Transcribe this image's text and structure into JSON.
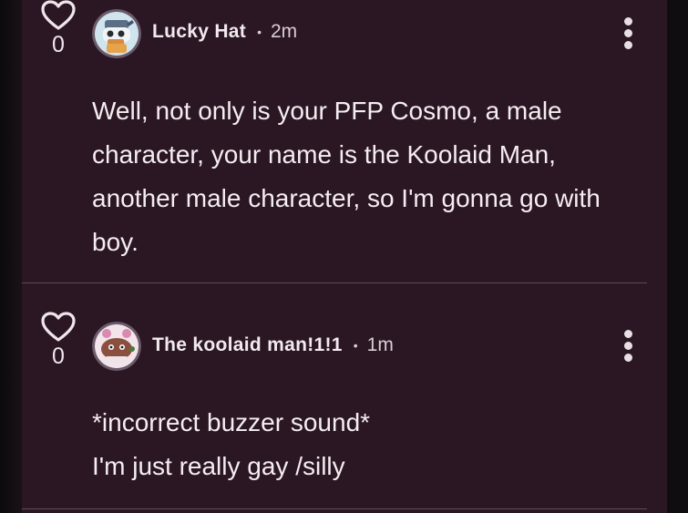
{
  "comments": [
    {
      "likes": "0",
      "username": "Lucky Hat",
      "separator": "•",
      "time": "2m",
      "text_lines": [
        "Well, not only is your PFP Cosmo, a male",
        "character, your name is the Koolaid Man,",
        "another male character, so I'm gonna go with",
        "boy."
      ],
      "avatar_icon": "cartoon-character-avatar",
      "heart_icon": "heart-outline-icon",
      "menu_icon": "more-vertical-icon"
    },
    {
      "likes": "0",
      "username": "The koolaid man!1!1",
      "separator": "•",
      "time": "1m",
      "text_lines": [
        "*incorrect buzzer sound*",
        "I'm just really gay /silly"
      ],
      "avatar_icon": "cartoon-creature-avatar",
      "heart_icon": "heart-outline-icon",
      "menu_icon": "more-vertical-icon"
    }
  ],
  "colors": {
    "panel_background": "#2b1623",
    "text": "#f4edf1",
    "divider": "#5f4a55"
  }
}
